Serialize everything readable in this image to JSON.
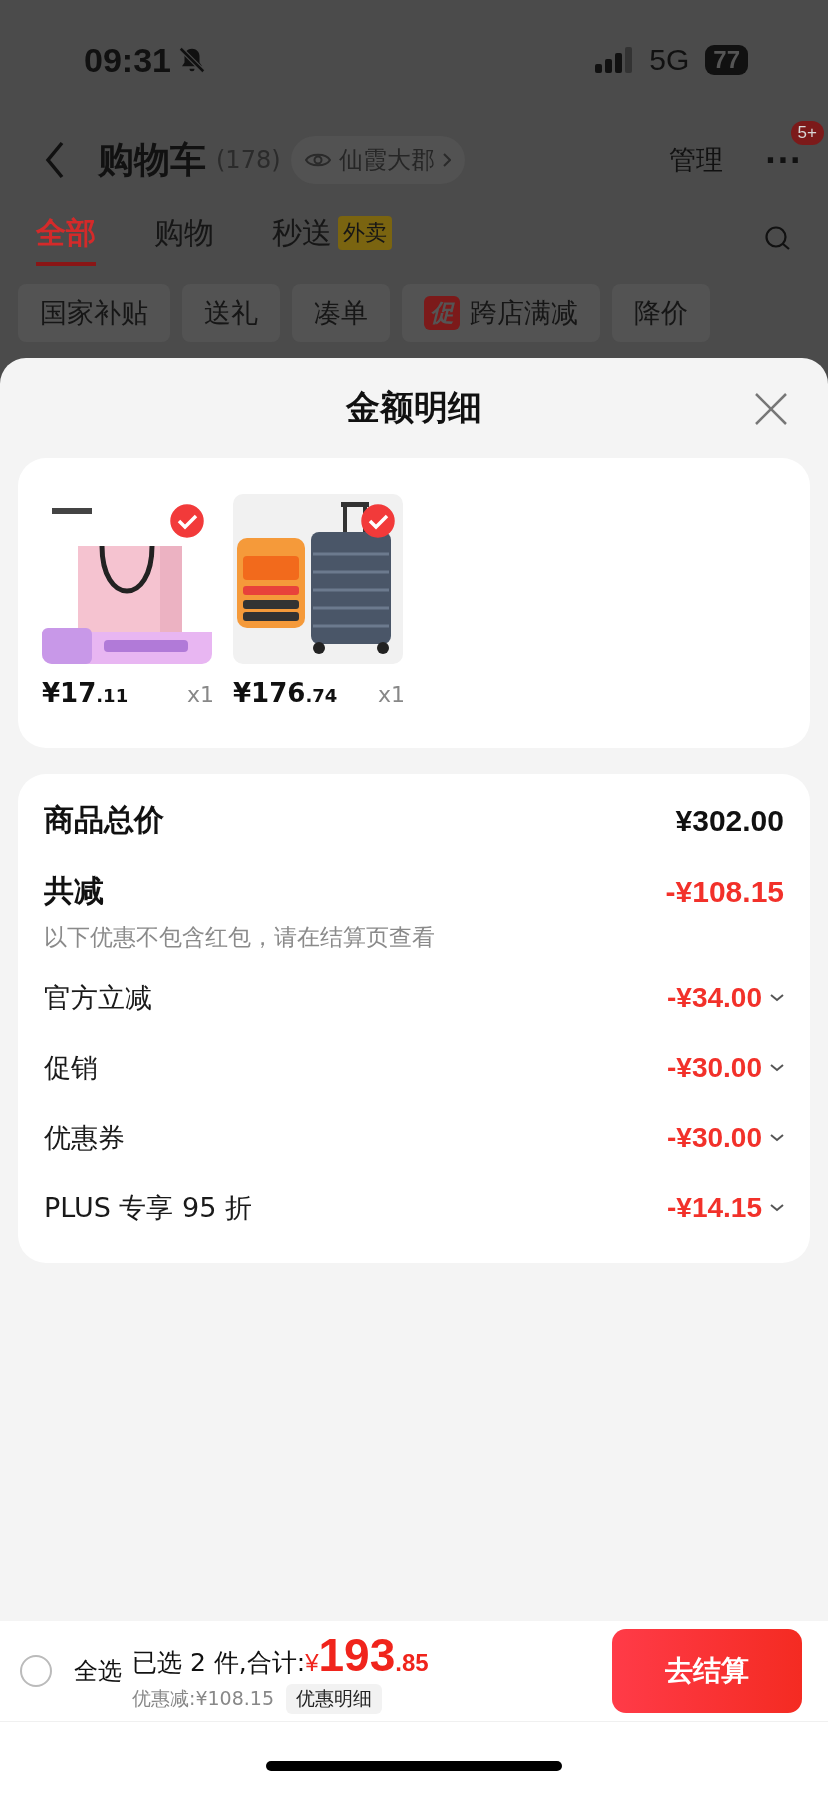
{
  "status_bar": {
    "time": "09:31",
    "network": "5G",
    "battery": "77"
  },
  "header": {
    "title": "购物车",
    "count": "(178)",
    "location": "仙霞大郡",
    "manage": "管理",
    "more": "···",
    "badge": "5+"
  },
  "tabs": [
    {
      "label": "全部",
      "selected": true
    },
    {
      "label": "购物",
      "selected": false
    },
    {
      "label": "秒送",
      "tag": "外卖",
      "selected": false
    }
  ],
  "filters": [
    {
      "label": "国家补贴"
    },
    {
      "label": "送礼"
    },
    {
      "label": "凑单"
    },
    {
      "label": "跨店满减",
      "promo": "促"
    },
    {
      "label": "降价"
    }
  ],
  "sheet": {
    "title": "金额明细",
    "products": [
      {
        "kind": "bag",
        "selected": true,
        "price_int": "¥17",
        "price_dec": ".11",
        "qty": "x1"
      },
      {
        "kind": "suitcase",
        "selected": true,
        "price_int": "¥176",
        "price_dec": ".74",
        "qty": "x1"
      }
    ],
    "total": {
      "label": "商品总价",
      "value": "¥302.00"
    },
    "reduction": {
      "label": "共减",
      "value": "-¥108.15",
      "note": "以下优惠不包含红包，请在结算页查看"
    },
    "discounts": [
      {
        "label": "官方立减",
        "value": "-¥34.00"
      },
      {
        "label": "促销",
        "value": "-¥30.00"
      },
      {
        "label": "优惠券",
        "value": "-¥30.00"
      },
      {
        "label": "PLUS 专享 95 折",
        "value": "-¥14.15"
      }
    ]
  },
  "footer": {
    "select_all": {
      "label": "全选",
      "checked": false
    },
    "summary": "已选 2 件,合计:",
    "currency": "¥",
    "amount_int": "193",
    "amount_dec": ".85",
    "saved": "优惠减:¥108.15",
    "detail": "优惠明细",
    "checkout": "去结算"
  }
}
